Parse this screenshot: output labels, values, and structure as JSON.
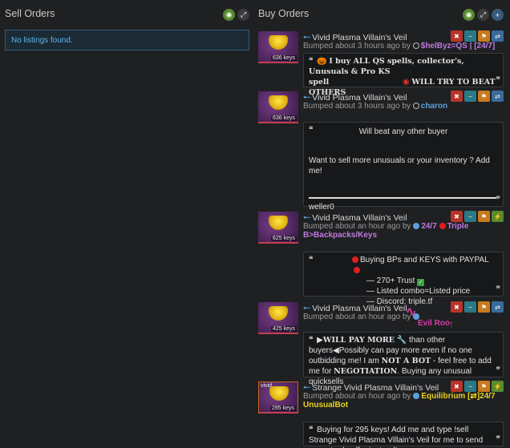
{
  "sell": {
    "title": "Sell Orders",
    "empty_text": "No listings found."
  },
  "buy": {
    "title": "Buy Orders"
  },
  "colors": {
    "accent": "#5aa6e6",
    "empty_bg": "#1b2a35",
    "empty_text": "#5db8e6",
    "scribble": "#d83aa8"
  },
  "listings": [
    {
      "name": "Vivid Plasma Villain's Veil",
      "price": "636 keys",
      "bumped": "Bumped about 3 hours ago by",
      "user": "$helByz=QS | [24/7]",
      "user_color": "#c07ae0",
      "comment_lines": [
        "I buy ALL QS spells, collector's, Unusuals & Pro KS",
        "spell",
        "WILL TRY TO BEAT OTHERS"
      ],
      "actions": [
        "close-icon",
        "minus-icon",
        "flag-icon",
        "swap-icon"
      ]
    },
    {
      "name": "Vivid Plasma Villain's Veil",
      "price": "636 keys",
      "bumped": "Bumped about 3 hours ago by",
      "user": "charon",
      "user_color": "#5aa0e0",
      "comment_lines": [
        "Will beat any other buyer",
        "Want to sell more unusuals or your inventory ? Add me!",
        "weller0"
      ],
      "actions": [
        "close-icon",
        "minus-icon",
        "flag-icon",
        "swap-icon"
      ]
    },
    {
      "name": "Vivid Plasma Villain's Veil",
      "price": "625 keys",
      "bumped": "Bumped about an hour ago by",
      "user": "24/7",
      "user2a": "Triple",
      "user2b": "B>Backpacks/Keys",
      "user_color": "#c07ae0",
      "comment_lines": [
        "Buying BPs and KEYS with PAYPAL",
        "— 270+ Trust",
        "— Listed combo=Listed price",
        "— Discord: triple.tf"
      ],
      "actions": [
        "close-icon",
        "minus-icon",
        "flag-icon",
        "bolt-icon"
      ]
    },
    {
      "name": "Vivid Plasma Villain's Veil",
      "price": "425 keys",
      "bumped": "Bumped about an hour ago by",
      "user": "Evil Roo",
      "user_color": "#d83aa8",
      "comment_lines": [
        "WILL PAY MORE",
        "than other buyers",
        "Possibly can pay more even if no one outbidding me! I am",
        "NOT A BOT",
        "- feel free to add me for",
        "NEGOTIATION",
        ". Buying any unusual quicksells"
      ],
      "actions": [
        "close-icon",
        "minus-icon",
        "flag-icon",
        "swap-icon"
      ]
    },
    {
      "name": "Strange Vivid Plasma Villain's Veil",
      "quality": "vivid",
      "price": "295 keys",
      "bumped": "Bumped about an hour ago by",
      "user": "Equilibrium [⇄]24/7",
      "user2b": "UnusualBot",
      "user_color": "#e8d020",
      "comment_lines": [
        "Buying for 295 keys! Add me and type !sell Strange Vivid Plasma Villain's Veil for me to send you a trade offer instead!"
      ],
      "actions": [
        "close-icon",
        "minus-icon",
        "flag-icon",
        "bolt-icon"
      ]
    }
  ]
}
